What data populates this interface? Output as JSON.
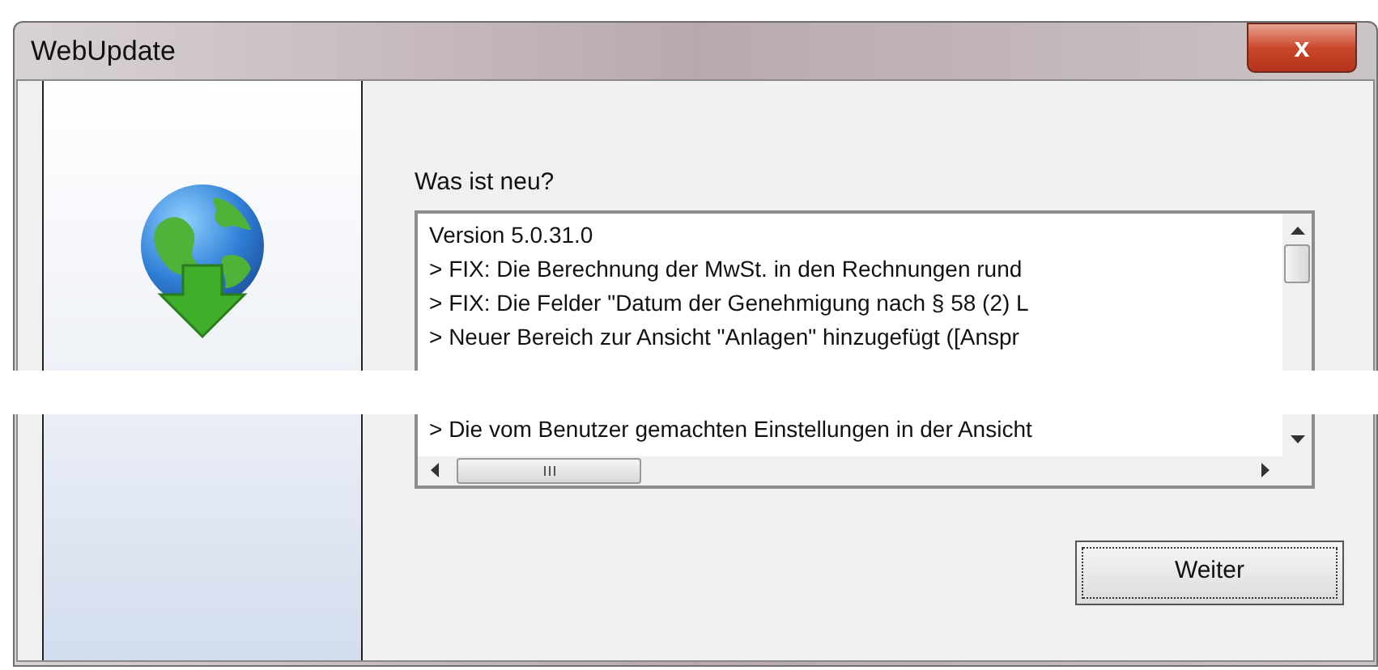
{
  "window": {
    "title": "WebUpdate",
    "close": "x"
  },
  "news": {
    "label": "Was ist neu?",
    "lines": [
      "Version 5.0.31.0",
      "> FIX: Die Berechnung der MwSt. in den Rechnungen rund",
      "> FIX: Die Felder \"Datum der Genehmigung nach § 58 (2) L",
      "> Neuer Bereich zur Ansicht \"Anlagen\" hinzugefügt ([Anspr",
      "> Die vom Benutzer gemachten Einstellungen in der Ansicht"
    ]
  },
  "buttons": [
    "Weiter"
  ]
}
